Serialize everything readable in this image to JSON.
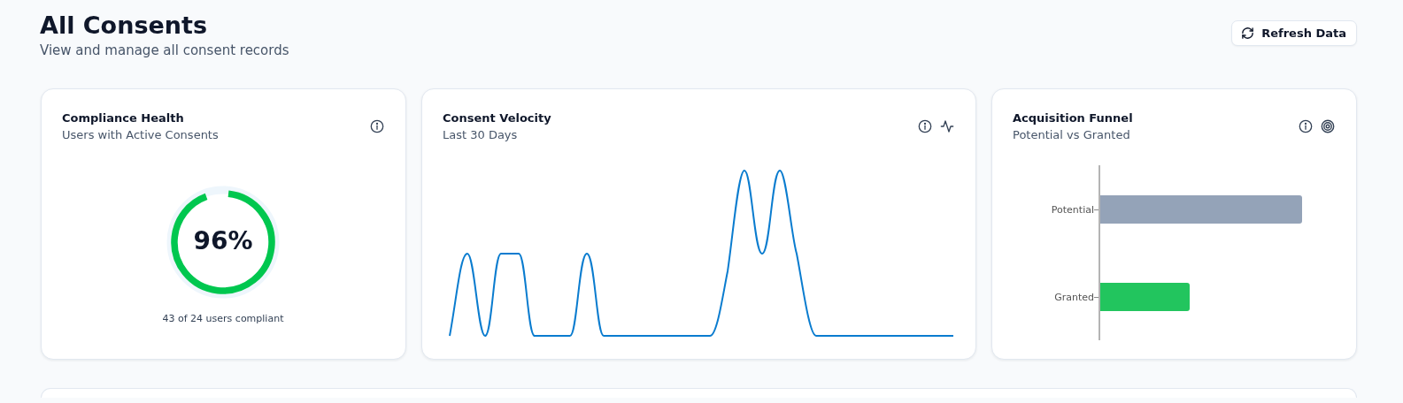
{
  "header": {
    "title": "All Consents",
    "subtitle": "View and manage all consent records",
    "refresh_button": "Refresh Data"
  },
  "compliance_health": {
    "title": "Compliance Health",
    "subtitle": "Users with Active Consents",
    "percent": "96%",
    "level": 0.96,
    "caption": "43 of 24 users compliant"
  },
  "consent_velocity": {
    "title": "Consent Velocity",
    "subtitle": "Last 30 Days"
  },
  "acquisition_funnel": {
    "title": "Acquisition Funnel",
    "subtitle": "Potential vs Granted",
    "bars": [
      {
        "label": "Potential",
        "color": "#94a3b8"
      },
      {
        "label": "Granted",
        "color": "#22c55e"
      }
    ]
  }
}
